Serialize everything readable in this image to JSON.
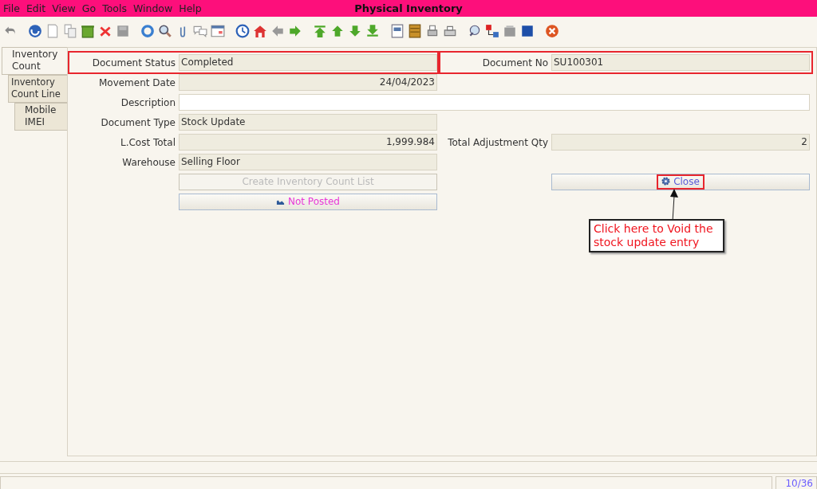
{
  "window": {
    "title": "Physical Inventory"
  },
  "menu": [
    {
      "label": "File"
    },
    {
      "label": "Edit"
    },
    {
      "label": "View"
    },
    {
      "label": "Go"
    },
    {
      "label": "Tools"
    },
    {
      "label": "Window"
    },
    {
      "label": "Help"
    }
  ],
  "tabs": [
    {
      "label": "Inventory Count",
      "selected": true,
      "children": [
        {
          "label": "Inventory Count Line",
          "selected": false,
          "children": [
            {
              "label": "Mobile IMEI",
              "selected": false
            }
          ]
        }
      ]
    }
  ],
  "form_rows": [
    {
      "cells": [
        {
          "kind": "text_field",
          "label": "Document Status",
          "value": "Completed",
          "editable": false,
          "highlighted": true
        },
        {
          "kind": "text_field",
          "label": "Document No",
          "value": "SU100301",
          "editable": false,
          "highlighted": true
        }
      ]
    },
    {
      "cells": [
        {
          "kind": "number_field",
          "label": "Movement Date",
          "value": "24/04/2023",
          "editable": false,
          "highlighted": false
        }
      ]
    },
    {
      "cells": [
        {
          "kind": "wide_field",
          "label": "Description",
          "editable": true,
          "highlighted": false
        }
      ]
    },
    {
      "cells": [
        {
          "kind": "text_field",
          "label": "Document Type",
          "value": "Stock Update",
          "editable": false,
          "highlighted": false
        }
      ]
    },
    {
      "cells": [
        {
          "kind": "number_field",
          "label": "L.Cost Total",
          "value": "1,999.984",
          "editable": false,
          "highlighted": false
        },
        {
          "kind": "number_field",
          "label": "Total Adjustment Qty",
          "value": "2",
          "editable": false,
          "highlighted": false
        }
      ]
    },
    {
      "cells": [
        {
          "kind": "text_field",
          "label": "Warehouse",
          "value": "Selling Floor",
          "editable": false,
          "highlighted": false
        }
      ]
    },
    {
      "cells": [
        {
          "kind": "plain_button",
          "label": "Create Inventory Count List",
          "disabled": true,
          "highlighted": false
        },
        {
          "kind": "process_button",
          "label": "Close",
          "disabled": false,
          "highlighted": true
        }
      ]
    },
    {
      "cells": [
        {
          "kind": "posting_button",
          "label": "Not Posted",
          "disabled": false,
          "highlighted": false
        }
      ]
    }
  ],
  "callout": {
    "text": "Click here to Void the stock update entry"
  },
  "status_bar": {
    "record": "10/36"
  }
}
